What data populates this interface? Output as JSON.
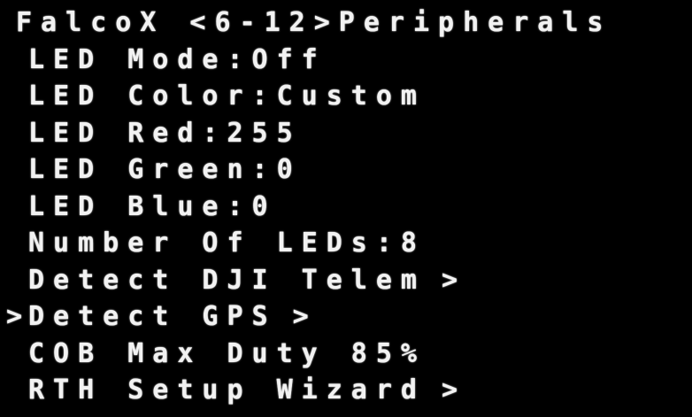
{
  "title": "FalcoX <6-12>Peripherals",
  "cursor_symbol": ">",
  "items": [
    {
      "label": "LED Mode:Off",
      "arrow": ""
    },
    {
      "label": "LED Color:Custom",
      "arrow": ""
    },
    {
      "label": "LED Red:255",
      "arrow": ""
    },
    {
      "label": "LED Green:0",
      "arrow": ""
    },
    {
      "label": "LED Blue:0",
      "arrow": ""
    },
    {
      "label": "Number Of LEDs:8",
      "arrow": ""
    },
    {
      "label": "Detect DJI Telem",
      "arrow": ">"
    },
    {
      "label": "Detect GPS",
      "arrow": ">"
    },
    {
      "label": "COB Max Duty 85%",
      "arrow": ""
    },
    {
      "label": "RTH Setup Wizard",
      "arrow": ">"
    }
  ],
  "selected_index": 7
}
